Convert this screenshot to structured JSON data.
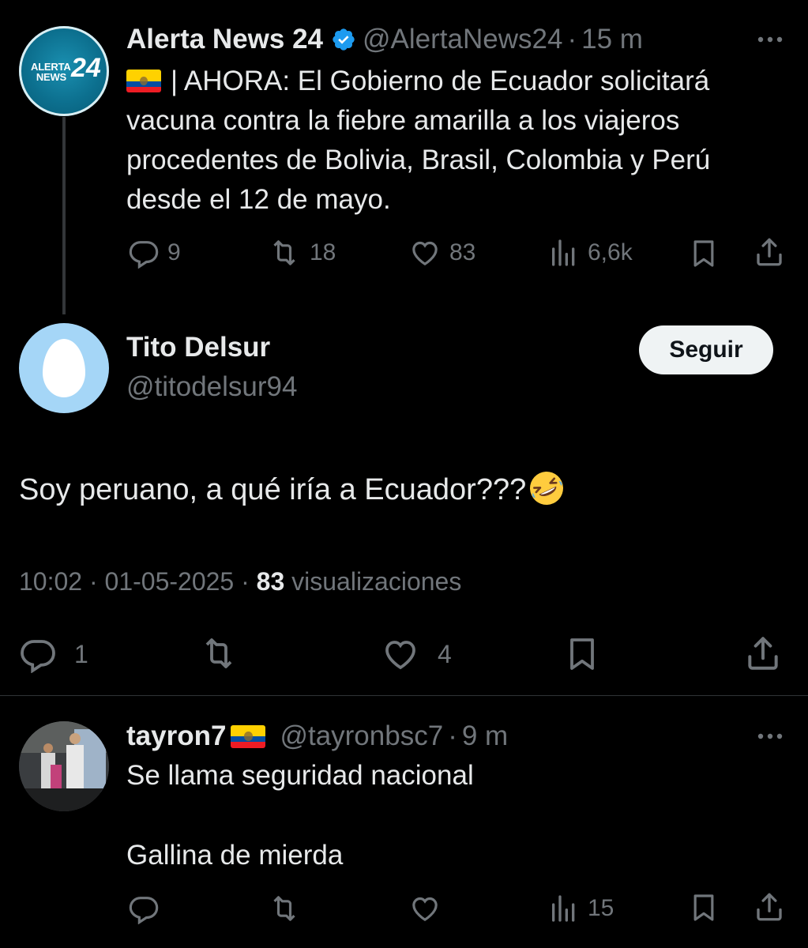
{
  "post1": {
    "author_name": "Alerta News 24",
    "handle": "@AlertaNews24",
    "separator": "·",
    "time": "15 m",
    "avatar_text_1": "ALERTA",
    "avatar_text_2": "NEWS",
    "avatar_text_3": "24",
    "text": "| AHORA: El Gobierno de Ecuador solicitará vacuna contra la fiebre amarilla a los viajeros procedentes de Bolivia, Brasil, Colombia y Perú desde el 12 de mayo.",
    "replies": "9",
    "reposts": "18",
    "likes": "83",
    "views": "6,6k"
  },
  "post2": {
    "author_name": "Tito Delsur",
    "handle": "@titodelsur94",
    "follow_label": "Seguir",
    "text": "Soy peruano, a qué iría a Ecuador???",
    "time": "10:02",
    "separator": "·",
    "date": "01-05-2025",
    "views_count": "83",
    "views_label": "visualizaciones",
    "replies": "1",
    "likes": "4"
  },
  "post3": {
    "author_name": "tayron7",
    "handle": "@tayronbsc7",
    "separator": "·",
    "time": "9 m",
    "text_line_1": "Se llama seguridad nacional",
    "text_line_2": "Gallina de mierda",
    "views": "15"
  },
  "colors": {
    "background": "#000000",
    "text": "#e7e9ea",
    "muted": "#71767b",
    "verified": "#1d9bf0",
    "divider": "#2f3336"
  },
  "icons": {
    "reply": "speech-bubble",
    "repost": "two-arrows-loop",
    "like": "heart",
    "views": "bar-chart",
    "bookmark": "bookmark",
    "share": "upload-arrow",
    "more": "three-dots",
    "verified": "badge-check"
  }
}
